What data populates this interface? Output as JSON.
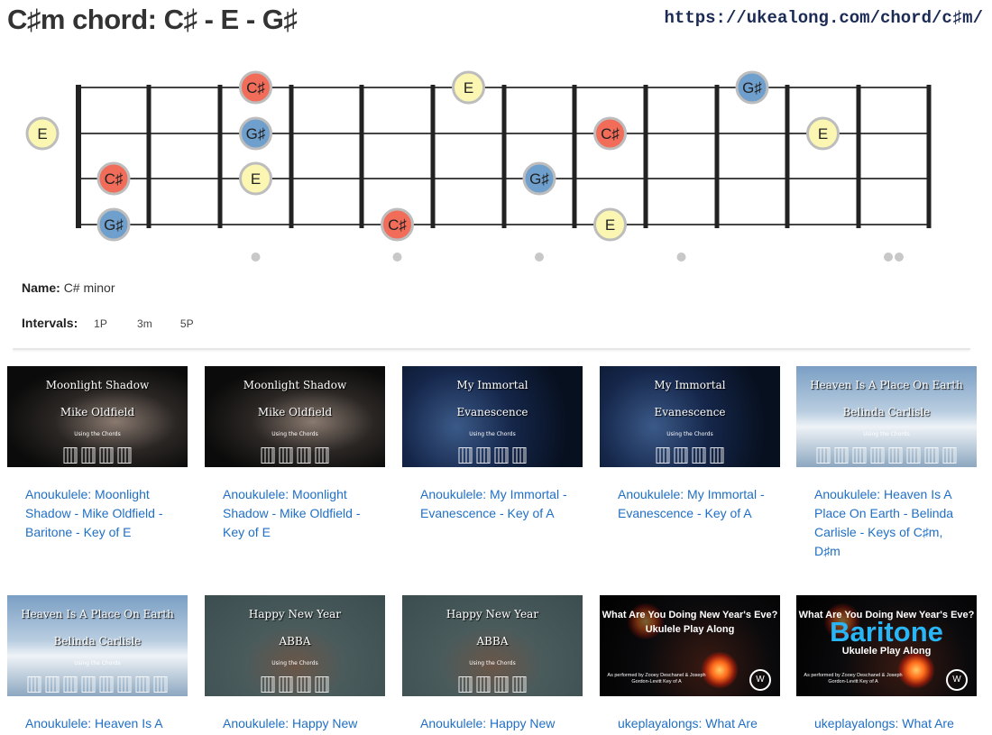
{
  "header": {
    "title": "C♯m chord: C♯ - E - G♯",
    "url": "https://ukealong.com/chord/c♯m/"
  },
  "fretboard": {
    "notes": [
      {
        "string": 0,
        "fret": 3,
        "label": "C♯",
        "color": "#f26c5a"
      },
      {
        "string": 0,
        "fret": 6,
        "label": "E",
        "color": "#fbf6b2"
      },
      {
        "string": 0,
        "fret": 10,
        "label": "G♯",
        "color": "#6f9fcd"
      },
      {
        "string": 1,
        "fret": 0,
        "label": "E",
        "color": "#fbf6b2"
      },
      {
        "string": 1,
        "fret": 3,
        "label": "G♯",
        "color": "#6f9fcd"
      },
      {
        "string": 1,
        "fret": 8,
        "label": "C♯",
        "color": "#f26c5a"
      },
      {
        "string": 1,
        "fret": 11,
        "label": "E",
        "color": "#fbf6b2"
      },
      {
        "string": 2,
        "fret": 1,
        "label": "C♯",
        "color": "#f26c5a"
      },
      {
        "string": 2,
        "fret": 3,
        "label": "E",
        "color": "#fbf6b2"
      },
      {
        "string": 2,
        "fret": 7,
        "label": "G♯",
        "color": "#6f9fcd"
      },
      {
        "string": 3,
        "fret": 1,
        "label": "G♯",
        "color": "#6f9fcd"
      },
      {
        "string": 3,
        "fret": 5,
        "label": "C♯",
        "color": "#f26c5a"
      },
      {
        "string": 3,
        "fret": 8,
        "label": "E",
        "color": "#fbf6b2"
      }
    ],
    "markers": [
      3,
      5,
      7,
      9,
      12
    ]
  },
  "info": {
    "name_label": "Name:",
    "name_value": "C# minor",
    "intervals_label": "Intervals:",
    "intervals": [
      "1P",
      "3m",
      "5P"
    ]
  },
  "videos": [
    {
      "caption": "Anoukulele: Moonlight Shadow - Mike Oldfield - Baritone - Key of E",
      "thumb_title": "Moonlight Shadow",
      "thumb_artist": "Mike Oldfield",
      "thumb_sub": "Using the Chords",
      "style": "dark"
    },
    {
      "caption": "Anoukulele: Moonlight Shadow - Mike Oldfield - Key of E",
      "thumb_title": "Moonlight Shadow",
      "thumb_artist": "Mike Oldfield",
      "thumb_sub": "Using the Chords",
      "style": "dark"
    },
    {
      "caption": "Anoukulele: My Immortal - Evanescence - Key of A",
      "thumb_title": "My Immortal",
      "thumb_artist": "Evanescence",
      "thumb_sub": "Using the Chords",
      "style": "blue"
    },
    {
      "caption": "Anoukulele: My Immortal - Evanescence - Key of A",
      "thumb_title": "My Immortal",
      "thumb_artist": "Evanescence",
      "thumb_sub": "Using the Chords",
      "style": "blue"
    },
    {
      "caption": "Anoukulele: Heaven Is A Place On Earth - Belinda Carlisle - Keys of C♯m, D♯m",
      "thumb_title": "Heaven Is A Place On Earth",
      "thumb_artist": "Belinda Carlisle",
      "thumb_sub": "Using the Chords",
      "style": "sky"
    },
    {
      "caption": "Anoukulele: Heaven Is A",
      "thumb_title": "Heaven Is A Place On Earth",
      "thumb_artist": "Belinda Carlisle",
      "thumb_sub": "Using the Chords",
      "style": "sky"
    },
    {
      "caption": "Anoukulele: Happy New",
      "thumb_title": "Happy New Year",
      "thumb_artist": "ABBA",
      "thumb_sub": "Using the Chords",
      "style": "girl"
    },
    {
      "caption": "Anoukulele: Happy New",
      "thumb_title": "Happy New Year",
      "thumb_artist": "ABBA",
      "thumb_sub": "Using the Chords",
      "style": "girl"
    },
    {
      "caption": "ukeplayalongs: What Are",
      "thumb_line1": "What Are You Doing New Year's Eve?",
      "thumb_line2": "Ukulele Play Along",
      "thumb_credit": "As performed by Zooey Deschanel & Joseph Gordon-Levitt Key of A",
      "style": "night"
    },
    {
      "caption": "ukeplayalongs: What Are",
      "thumb_line1": "What Are You Doing New Year's Eve?",
      "thumb_big": "Baritone",
      "thumb_line2": "Ukulele Play Along",
      "thumb_credit": "As performed by Zooey Deschanel & Joseph Gordon-Levitt Key of A",
      "style": "night"
    }
  ]
}
